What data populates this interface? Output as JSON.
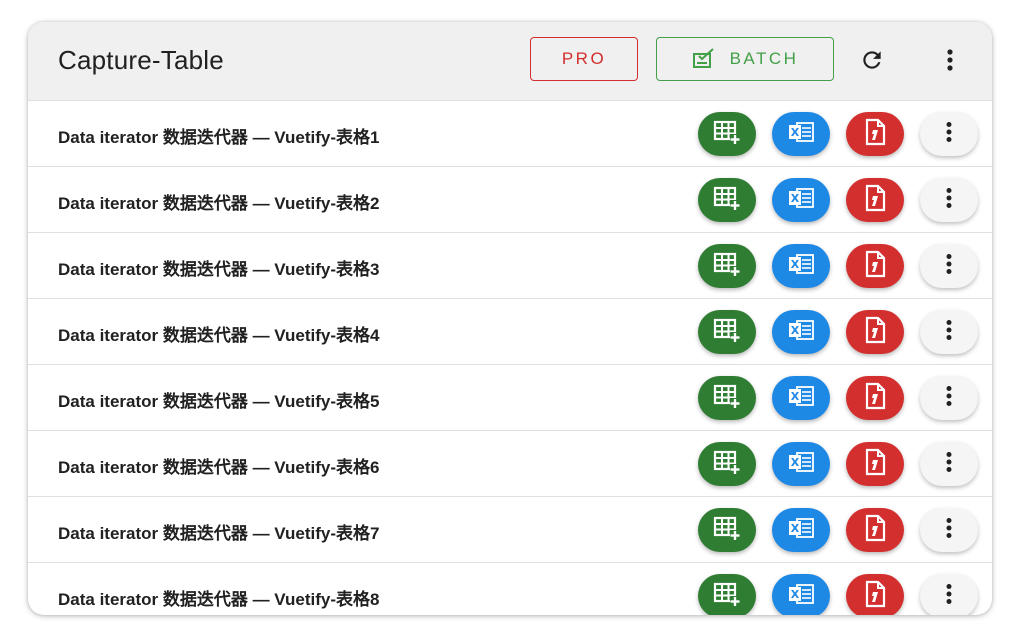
{
  "header": {
    "title": "Capture-Table",
    "pro_label": "PRO",
    "batch_label": "BATCH",
    "icons": [
      "batch-check-icon",
      "refresh-icon",
      "more-vertical-icon"
    ]
  },
  "rows": [
    {
      "label": "Data iterator 数据迭代器 — Vuetify-表格1"
    },
    {
      "label": "Data iterator 数据迭代器 — Vuetify-表格2"
    },
    {
      "label": "Data iterator 数据迭代器 — Vuetify-表格3"
    },
    {
      "label": "Data iterator 数据迭代器 — Vuetify-表格4"
    },
    {
      "label": "Data iterator 数据迭代器 — Vuetify-表格5"
    },
    {
      "label": "Data iterator 数据迭代器 — Vuetify-表格6"
    },
    {
      "label": "Data iterator 数据迭代器 — Vuetify-表格7"
    },
    {
      "label": "Data iterator 数据迭代器 — Vuetify-表格8"
    }
  ],
  "row_actions": [
    "table-add-icon",
    "excel-icon",
    "pdf-icon",
    "more-vertical-icon"
  ],
  "colors": {
    "green": "#2e7d32",
    "blue": "#1e88e5",
    "red": "#d32f2f",
    "batch_green": "#43a047"
  }
}
